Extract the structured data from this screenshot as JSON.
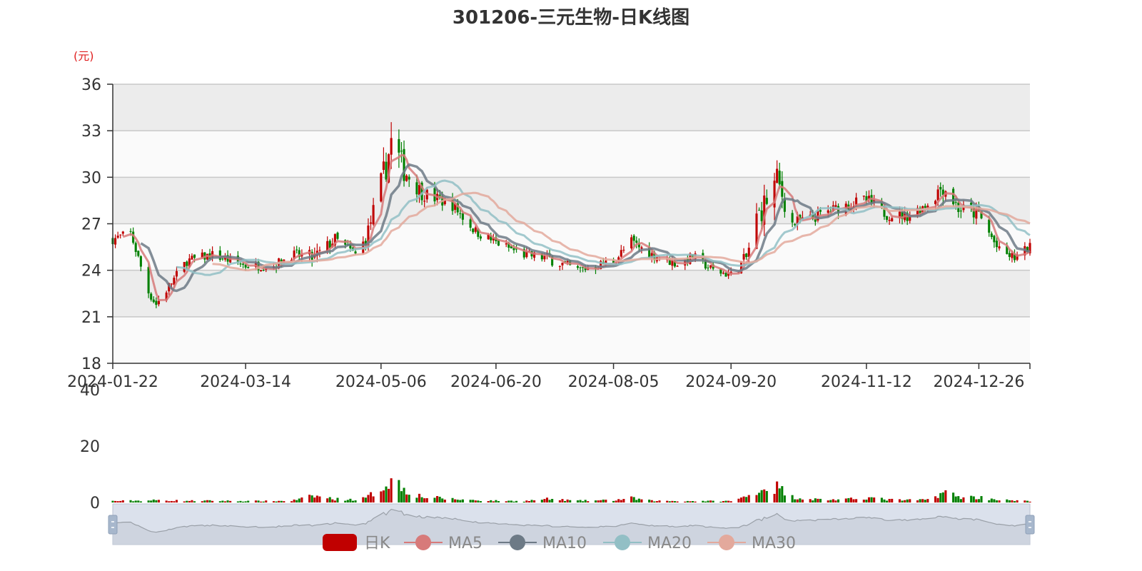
{
  "chart_data": {
    "type": "candlestick",
    "title": "301206-三元生物-日K线图",
    "y_unit": "(元)",
    "ylim": [
      18,
      36
    ],
    "y_ticks": [
      18,
      21,
      24,
      27,
      30,
      33,
      36
    ],
    "x_range": [
      "2024-01-22",
      "2025-01-15"
    ],
    "x_ticks": [
      "2024-01-22",
      "2024-03-14",
      "2024-05-06",
      "2024-06-20",
      "2024-08-05",
      "2024-09-20",
      "2024-11-12",
      "2024-12-26"
    ],
    "volume_ylim": [
      0,
      40
    ],
    "volume_ticks": [
      0,
      20,
      40
    ],
    "grid": true,
    "legend_position": "bottom",
    "legend": [
      "日K",
      "MA5",
      "MA10",
      "MA20",
      "MA30"
    ],
    "colors": {
      "up": "#c00000",
      "down": "#008000",
      "ma5": "#d77a7a",
      "ma10": "#6d7a86",
      "ma20": "#92bfc5",
      "ma30": "#e3a99c",
      "unit": "#e02020",
      "band": "#ececec",
      "zoom_fill": "#dbe1ec",
      "zoom_line": "#9aa0a8"
    },
    "anchors": [
      [
        "2024-01-22",
        26.0,
        0.5
      ],
      [
        "2024-01-29",
        26.4,
        0.6
      ],
      [
        "2024-02-05",
        22.6,
        0.7
      ],
      [
        "2024-02-08",
        21.8,
        0.8
      ],
      [
        "2024-02-20",
        24.6,
        0.6
      ],
      [
        "2024-03-01",
        25.0,
        0.6
      ],
      [
        "2024-03-14",
        24.3,
        0.5
      ],
      [
        "2024-03-25",
        24.3,
        0.5
      ],
      [
        "2024-04-01",
        25.0,
        0.6
      ],
      [
        "2024-04-10",
        24.8,
        2.3
      ],
      [
        "2024-04-18",
        26.0,
        1.2
      ],
      [
        "2024-04-26",
        25.0,
        1.0
      ],
      [
        "2024-04-30",
        26.0,
        1.5
      ],
      [
        "2024-05-06",
        29.5,
        5.0
      ],
      [
        "2024-05-10",
        32.2,
        8.5
      ],
      [
        "2024-05-15",
        30.5,
        5.0
      ],
      [
        "2024-05-22",
        29.0,
        2.0
      ],
      [
        "2024-06-03",
        28.2,
        1.2
      ],
      [
        "2024-06-12",
        26.5,
        0.8
      ],
      [
        "2024-06-20",
        25.8,
        0.6
      ],
      [
        "2024-07-01",
        25.0,
        0.5
      ],
      [
        "2024-07-10",
        24.8,
        1.2
      ],
      [
        "2024-07-22",
        24.0,
        0.6
      ],
      [
        "2024-08-05",
        24.6,
        0.8
      ],
      [
        "2024-08-12",
        25.8,
        1.5
      ],
      [
        "2024-08-20",
        25.0,
        0.6
      ],
      [
        "2024-08-30",
        24.4,
        0.5
      ],
      [
        "2024-09-05",
        24.9,
        0.5
      ],
      [
        "2024-09-13",
        24.0,
        0.5
      ],
      [
        "2024-09-20",
        23.7,
        0.5
      ],
      [
        "2024-09-26",
        24.8,
        2.0
      ],
      [
        "2024-09-30",
        27.3,
        4.5
      ],
      [
        "2024-10-08",
        29.8,
        5.5
      ],
      [
        "2024-10-14",
        27.0,
        2.0
      ],
      [
        "2024-10-21",
        27.3,
        1.2
      ],
      [
        "2024-10-28",
        27.8,
        1.0
      ],
      [
        "2024-11-04",
        28.2,
        1.0
      ],
      [
        "2024-11-12",
        28.5,
        1.8
      ],
      [
        "2024-11-20",
        27.6,
        1.0
      ],
      [
        "2024-11-28",
        27.5,
        0.8
      ],
      [
        "2024-12-06",
        28.3,
        1.0
      ],
      [
        "2024-12-12",
        29.5,
        3.8
      ],
      [
        "2024-12-18",
        28.0,
        2.0
      ],
      [
        "2024-12-26",
        27.6,
        1.8
      ],
      [
        "2025-01-03",
        25.2,
        1.0
      ],
      [
        "2025-01-09",
        24.8,
        0.6
      ],
      [
        "2025-01-15",
        25.5,
        0.5
      ]
    ]
  },
  "zoom_slider": {
    "range": [
      0,
      100
    ]
  }
}
